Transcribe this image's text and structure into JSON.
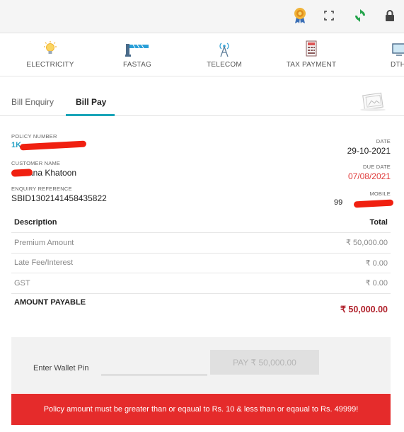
{
  "topbar": {
    "icons": [
      "award-badge-icon",
      "fullscreen-icon",
      "refresh-icon",
      "lock-icon"
    ],
    "colors": {
      "refresh": "#22a34a",
      "badge": "#e5a92b"
    }
  },
  "categories": [
    {
      "label": "ELECTRICITY",
      "icon": "bulb-icon"
    },
    {
      "label": "FASTAG",
      "icon": "toll-gate-icon"
    },
    {
      "label": "TELECOM",
      "icon": "antenna-icon"
    },
    {
      "label": "TAX PAYMENT",
      "icon": "receipt-icon"
    },
    {
      "label": "DTH",
      "icon": "tv-icon"
    }
  ],
  "tabs": [
    {
      "label": "Bill Enquiry",
      "active": false
    },
    {
      "label": "Bill Pay",
      "active": true
    }
  ],
  "info": {
    "policy_label": "POLICY NUMBER",
    "policy_value": "1K",
    "date_label": "DATE",
    "date_value": "29-10-2021",
    "customer_label": "CUSTOMER NAME",
    "customer_value": "ana Khatoon",
    "due_label": "DUE DATE",
    "due_value": "07/08/2021",
    "enquiry_label": "ENQUIRY REFERENCE",
    "enquiry_value": "SBID1302141458435822",
    "mobile_label": "MOBILE",
    "mobile_value": "99"
  },
  "table": {
    "headers": [
      "Description",
      "Total"
    ],
    "rows": [
      [
        "Premium Amount",
        "₹ 50,000.00"
      ],
      [
        "Late Fee/Interest",
        "₹ 0.00"
      ],
      [
        "GST",
        "₹ 0.00"
      ]
    ],
    "total": [
      "AMOUNT PAYABLE",
      "₹ 50,000.00"
    ]
  },
  "pay": {
    "pin_label": "Enter Wallet Pin",
    "button_label": "PAY ₹ 50,000.00"
  },
  "alert": "Policy amount must be greater than or eqaual to Rs. 10 & less than or eqaual to Rs. 49999!",
  "colors": {
    "accent": "#19a4b8",
    "alert": "#e52b2b",
    "due": "#e03a3a",
    "total": "#b0202a"
  }
}
